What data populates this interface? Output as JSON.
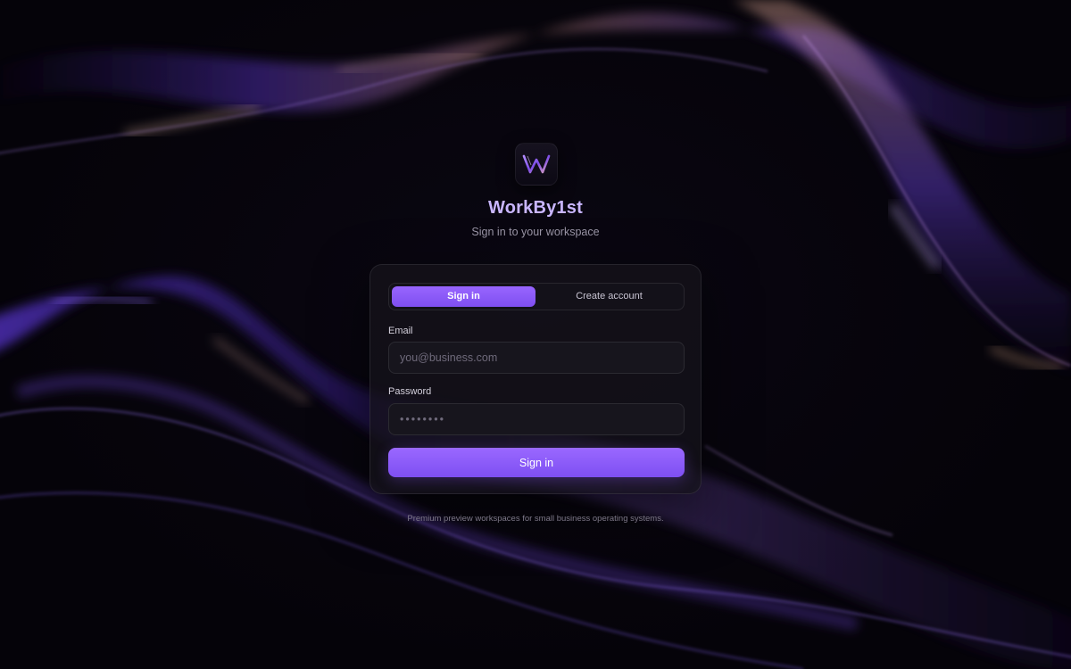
{
  "brand": {
    "logo_icon": "w-monogram-icon",
    "app_name": "WorkBy1st",
    "subtitle": "Sign in to your workspace"
  },
  "auth": {
    "tabs": [
      {
        "label": "Sign in",
        "active": true
      },
      {
        "label": "Create account",
        "active": false
      }
    ],
    "email": {
      "label": "Email",
      "placeholder": "you@business.com",
      "value": ""
    },
    "password": {
      "label": "Password",
      "placeholder": "••••••••",
      "value": ""
    },
    "submit_label": "Sign in"
  },
  "footer": {
    "text": "Premium preview workspaces for small business operating systems."
  },
  "colors": {
    "accent": "#8b5cf6",
    "accent_light": "#c9b6ff",
    "background": "#050309",
    "card": "#14121a"
  }
}
